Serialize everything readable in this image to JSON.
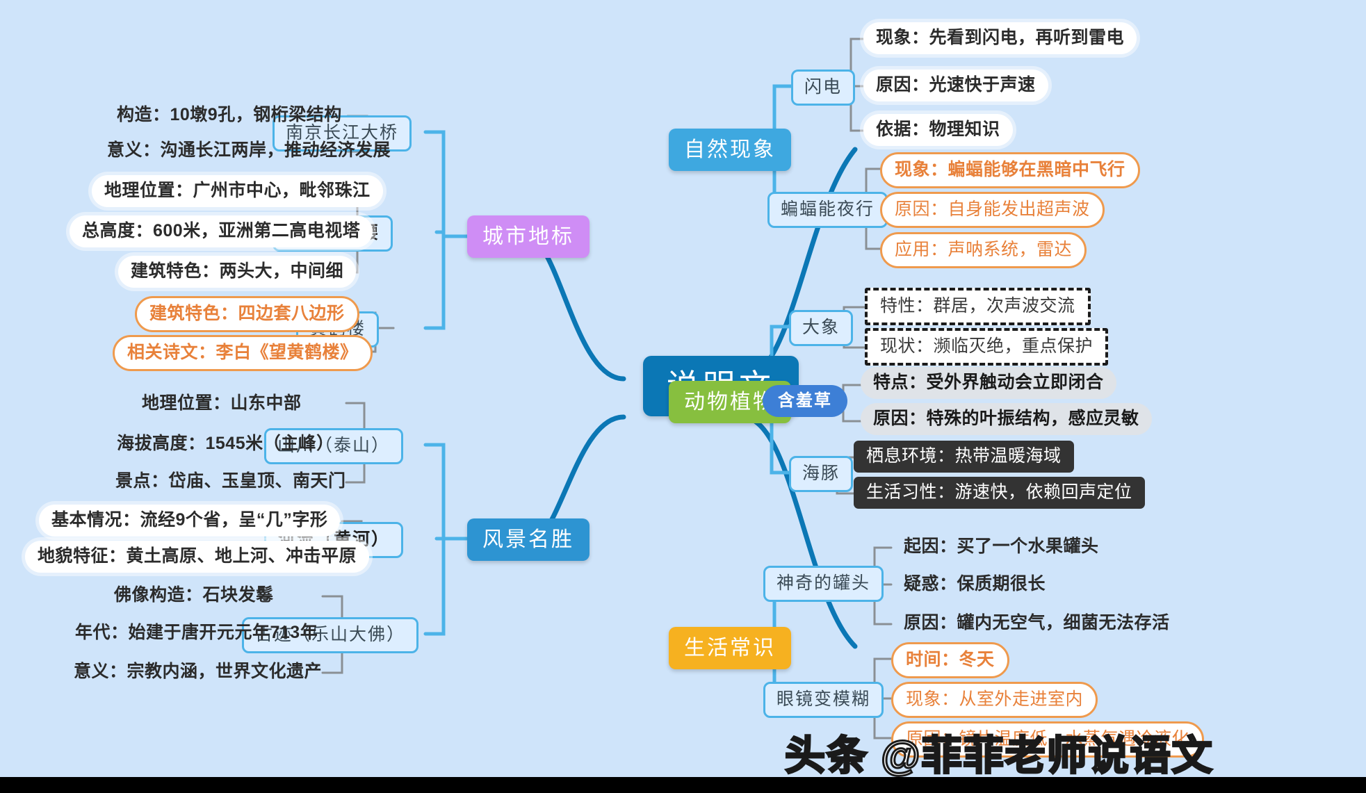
{
  "central": {
    "label": "说明文"
  },
  "watermark": {
    "text": "头条 @菲菲老师说语文"
  },
  "colors": {
    "background": "#cfe4fa",
    "central": "#0b77b5",
    "branch_blue": "#3ea8e0",
    "branch_green": "#87bf3f",
    "branch_orange": "#f6b120",
    "branch_purple": "#cf8df5",
    "branch_dblue": "#2d94d2",
    "node_border_blue": "#4cb3e8",
    "accent_orange": "#ef9a4d",
    "dark_box": "#333333",
    "gray_pill": "#dfe3e8",
    "pill_blue": "#3d7fd6"
  },
  "branches": {
    "natural": {
      "label": "自然现象",
      "children": [
        {
          "label": "闪电",
          "items": [
            "现象：先看到闪电，再听到雷电",
            "原因：光速快于声速",
            "依据：物理知识"
          ]
        },
        {
          "label": "蝙蝠能夜行",
          "items": [
            "现象：蝙蝠能够在黑暗中飞行",
            "原因：自身能发出超声波",
            "应用：声呐系统，雷达"
          ]
        }
      ]
    },
    "animals": {
      "label": "动物植物",
      "children": [
        {
          "label": "大象",
          "items": [
            "特性：群居，次声波交流",
            "现状：濒临灭绝，重点保护"
          ]
        },
        {
          "label": "含羞草",
          "items": [
            "特点：受外界触动会立即闭合",
            "原因：特殊的叶振结构，感应灵敏"
          ]
        },
        {
          "label": "海豚",
          "items": [
            "栖息环境：热带温暖海域",
            "生活习性：游速快，依赖回声定位"
          ]
        }
      ]
    },
    "life": {
      "label": "生活常识",
      "children": [
        {
          "label": "神奇的罐头",
          "items": [
            "起因：买了一个水果罐头",
            "疑惑：保质期很长",
            "原因：罐内无空气，细菌无法存活"
          ]
        },
        {
          "label": "眼镜变模糊",
          "items": [
            "时间：冬天",
            "现象：从室外走进室内",
            "原因：镜片温度低，水蒸气遇冷液化"
          ]
        }
      ]
    },
    "landmarks": {
      "label": "城市地标",
      "children": [
        {
          "label": "南京长江大桥",
          "items": [
            "构造：10墩9孔，钢桁梁结构",
            "意义：沟通长江两岸，推动经济发展"
          ]
        },
        {
          "label": "广州小蛮腰",
          "items": [
            "地理位置：广州市中心，毗邻珠江",
            "总高度：600米，亚洲第二高电视塔",
            "建筑特色：两头大，中间细"
          ]
        },
        {
          "label": "黄鹤楼",
          "items": [
            "建筑特色：四边套八边形",
            "相关诗文：李白《望黄鹤楼》"
          ]
        }
      ]
    },
    "scenery": {
      "label": "风景名胜",
      "children": [
        {
          "label": "山川（泰山）",
          "items": [
            "地理位置：山东中部",
            "海拔高度：1545米（主峰）",
            "景点：岱庙、玉皇顶、南天门"
          ]
        },
        {
          "label": "河流（黄河）",
          "items": [
            "基本情况：流经9个省，呈“几”字形",
            "地貌特征：黄土高原、地上河、冲击平原"
          ]
        },
        {
          "label": "古迹（乐山大佛）",
          "items": [
            "佛像构造：石块发鬈",
            "年代：始建于唐开元元年713年",
            "意义：宗教内涵，世界文化遗产"
          ]
        }
      ]
    }
  }
}
